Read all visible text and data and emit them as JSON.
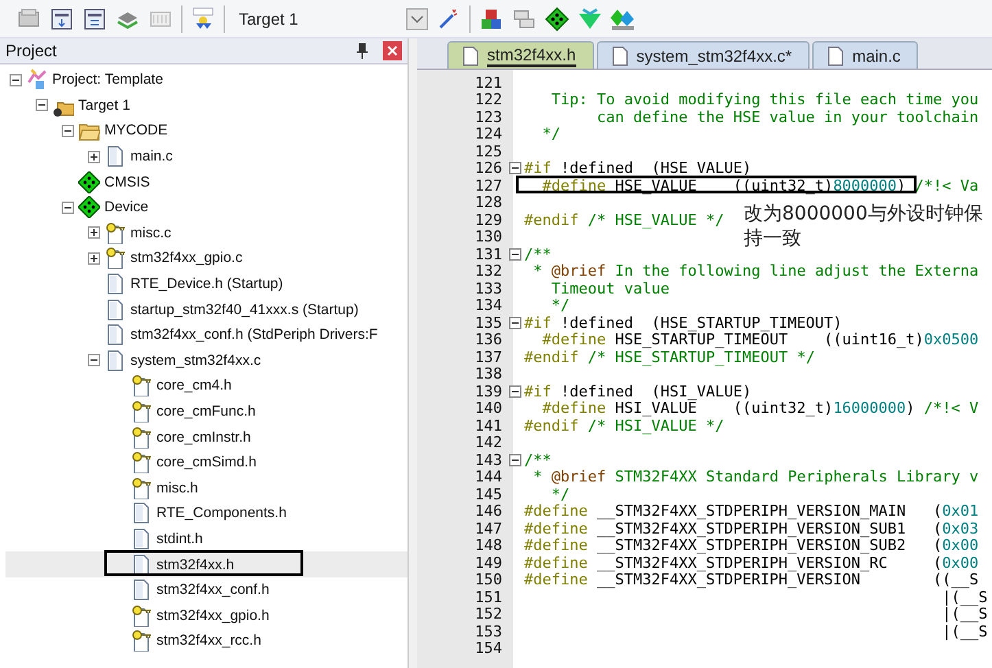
{
  "toolbar": {
    "target": "Target 1"
  },
  "project_panel": {
    "title": "Project",
    "tree": [
      {
        "label": "Project: Template",
        "kind": "project",
        "expanded": true,
        "children": [
          {
            "label": "Target 1",
            "kind": "target",
            "expanded": true,
            "children": [
              {
                "label": "MYCODE",
                "kind": "folder",
                "expanded": true,
                "children": [
                  {
                    "label": "main.c",
                    "kind": "file",
                    "expanded": false,
                    "selected": false,
                    "marked": false
                  }
                ]
              },
              {
                "label": "CMSIS",
                "kind": "component"
              },
              {
                "label": "Device",
                "kind": "component",
                "expanded": true,
                "children": [
                  {
                    "label": "misc.c",
                    "kind": "file-key",
                    "expanded": false,
                    "selected": false,
                    "marked": false
                  },
                  {
                    "label": "stm32f4xx_gpio.c",
                    "kind": "file-key",
                    "expanded": false,
                    "selected": false,
                    "marked": false
                  },
                  {
                    "label": "RTE_Device.h (Startup)",
                    "kind": "file",
                    "selected": false,
                    "marked": false
                  },
                  {
                    "label": "startup_stm32f40_41xxx.s (Startup)",
                    "kind": "file",
                    "selected": false,
                    "marked": false
                  },
                  {
                    "label": "stm32f4xx_conf.h (StdPeriph Drivers:F",
                    "kind": "file",
                    "selected": false,
                    "marked": false
                  },
                  {
                    "label": "system_stm32f4xx.c",
                    "kind": "file",
                    "expanded": true,
                    "selected": false,
                    "marked": false,
                    "children": [
                      {
                        "label": "core_cm4.h",
                        "kind": "file-key",
                        "selected": false,
                        "marked": false
                      },
                      {
                        "label": "core_cmFunc.h",
                        "kind": "file-key",
                        "selected": false,
                        "marked": false
                      },
                      {
                        "label": "core_cmInstr.h",
                        "kind": "file-key",
                        "selected": false,
                        "marked": false
                      },
                      {
                        "label": "core_cmSimd.h",
                        "kind": "file-key",
                        "selected": false,
                        "marked": false
                      },
                      {
                        "label": "misc.h",
                        "kind": "file-key",
                        "selected": false,
                        "marked": false
                      },
                      {
                        "label": "RTE_Components.h",
                        "kind": "file",
                        "selected": false,
                        "marked": false
                      },
                      {
                        "label": "stdint.h",
                        "kind": "file",
                        "selected": false,
                        "marked": false
                      },
                      {
                        "label": "stm32f4xx.h",
                        "kind": "file",
                        "selected": true,
                        "marked": true
                      },
                      {
                        "label": "stm32f4xx_conf.h",
                        "kind": "file",
                        "selected": false,
                        "marked": false
                      },
                      {
                        "label": "stm32f4xx_gpio.h",
                        "kind": "file-key",
                        "selected": false,
                        "marked": false
                      },
                      {
                        "label": "stm32f4xx_rcc.h",
                        "kind": "file-key",
                        "selected": false,
                        "marked": false
                      }
                    ]
                  }
                ]
              }
            ]
          }
        ]
      }
    ]
  },
  "tabs": [
    {
      "label": "stm32f4xx.h",
      "selected": true
    },
    {
      "label": "system_stm32f4xx.c*",
      "selected": false
    },
    {
      "label": "main.c",
      "selected": false
    }
  ],
  "editor": {
    "annotation": "改为8000000与外设时钟保持一致",
    "lines": [
      {
        "number": "121"
      },
      {
        "number": "122",
        "tokens": [
          {
            "kind": "cmt",
            "t": "   Tip: To avoid modifying this file each time you"
          }
        ]
      },
      {
        "number": "123",
        "tokens": [
          {
            "kind": "cmt",
            "t": "        can define the HSE value in your toolchain"
          }
        ]
      },
      {
        "number": "124",
        "tokens": [
          {
            "kind": "cmt",
            "t": "  */"
          }
        ]
      },
      {
        "number": "125"
      },
      {
        "number": "126",
        "fold": true,
        "tokens": [
          {
            "kind": "pp",
            "t": "#if"
          },
          {
            "kind": "plain",
            "t": " !defined  (HSE_VALUE)"
          }
        ]
      },
      {
        "number": "127",
        "marked": true,
        "tokens": [
          {
            "kind": "pp",
            "t": "  #define"
          },
          {
            "kind": "plain",
            "t": " HSE_VALUE    ((uint32_t)"
          },
          {
            "kind": "num",
            "t": "8000000"
          },
          {
            "kind": "plain",
            "t": ") "
          },
          {
            "kind": "cmt",
            "t": "/*!< Va"
          }
        ]
      },
      {
        "number": "128"
      },
      {
        "number": "129",
        "tokens": [
          {
            "kind": "pp",
            "t": "#endif"
          },
          {
            "kind": "cmt",
            "t": " /* HSE_VALUE */"
          }
        ]
      },
      {
        "number": "130"
      },
      {
        "number": "131",
        "fold": true,
        "tokens": [
          {
            "kind": "cmt",
            "t": "/**"
          }
        ]
      },
      {
        "number": "132",
        "tokens": [
          {
            "kind": "cmt",
            "t": " * "
          },
          {
            "kind": "doc",
            "t": "@brief"
          },
          {
            "kind": "cmt",
            "t": " In the following line adjust the Externa"
          }
        ]
      },
      {
        "number": "133",
        "tokens": [
          {
            "kind": "cmt",
            "t": "   Timeout value"
          }
        ]
      },
      {
        "number": "134",
        "tokens": [
          {
            "kind": "cmt",
            "t": "   */"
          }
        ]
      },
      {
        "number": "135",
        "fold": true,
        "tokens": [
          {
            "kind": "pp",
            "t": "#if"
          },
          {
            "kind": "plain",
            "t": " !defined  (HSE_STARTUP_TIMEOUT)"
          }
        ]
      },
      {
        "number": "136",
        "tokens": [
          {
            "kind": "pp",
            "t": "  #define"
          },
          {
            "kind": "plain",
            "t": " HSE_STARTUP_TIMEOUT    ((uint16_t)"
          },
          {
            "kind": "num",
            "t": "0x0500"
          }
        ]
      },
      {
        "number": "137",
        "tokens": [
          {
            "kind": "pp",
            "t": "#endif"
          },
          {
            "kind": "cmt",
            "t": " /* HSE_STARTUP_TIMEOUT */"
          }
        ]
      },
      {
        "number": "138"
      },
      {
        "number": "139",
        "fold": true,
        "tokens": [
          {
            "kind": "pp",
            "t": "#if"
          },
          {
            "kind": "plain",
            "t": " !defined  (HSI_VALUE)"
          }
        ]
      },
      {
        "number": "140",
        "tokens": [
          {
            "kind": "pp",
            "t": "  #define"
          },
          {
            "kind": "plain",
            "t": " HSI_VALUE    ((uint32_t)"
          },
          {
            "kind": "num",
            "t": "16000000"
          },
          {
            "kind": "plain",
            "t": ") "
          },
          {
            "kind": "cmt",
            "t": "/*!< V"
          }
        ]
      },
      {
        "number": "141",
        "tokens": [
          {
            "kind": "pp",
            "t": "#endif"
          },
          {
            "kind": "cmt",
            "t": " /* HSI_VALUE */"
          }
        ]
      },
      {
        "number": "142"
      },
      {
        "number": "143",
        "fold": true,
        "tokens": [
          {
            "kind": "cmt",
            "t": "/**"
          }
        ]
      },
      {
        "number": "144",
        "tokens": [
          {
            "kind": "cmt",
            "t": " * "
          },
          {
            "kind": "doc",
            "t": "@brief"
          },
          {
            "kind": "cmt",
            "t": " STM32F4XX Standard Peripherals Library v"
          }
        ]
      },
      {
        "number": "145",
        "tokens": [
          {
            "kind": "cmt",
            "t": "   */"
          }
        ]
      },
      {
        "number": "146",
        "tokens": [
          {
            "kind": "pp",
            "t": "#define"
          },
          {
            "kind": "plain",
            "t": " __STM32F4XX_STDPERIPH_VERSION_MAIN   ("
          },
          {
            "kind": "num",
            "t": "0x01"
          }
        ]
      },
      {
        "number": "147",
        "tokens": [
          {
            "kind": "pp",
            "t": "#define"
          },
          {
            "kind": "plain",
            "t": " __STM32F4XX_STDPERIPH_VERSION_SUB1   ("
          },
          {
            "kind": "num",
            "t": "0x03"
          }
        ]
      },
      {
        "number": "148",
        "tokens": [
          {
            "kind": "pp",
            "t": "#define"
          },
          {
            "kind": "plain",
            "t": " __STM32F4XX_STDPERIPH_VERSION_SUB2   ("
          },
          {
            "kind": "num",
            "t": "0x00"
          }
        ]
      },
      {
        "number": "149",
        "tokens": [
          {
            "kind": "pp",
            "t": "#define"
          },
          {
            "kind": "plain",
            "t": " __STM32F4XX_STDPERIPH_VERSION_RC     ("
          },
          {
            "kind": "num",
            "t": "0x00"
          }
        ]
      },
      {
        "number": "150",
        "tokens": [
          {
            "kind": "pp",
            "t": "#define"
          },
          {
            "kind": "plain",
            "t": " __STM32F4XX_STDPERIPH_VERSION        ((__S"
          }
        ]
      },
      {
        "number": "151",
        "tokens": [
          {
            "kind": "plain",
            "t": "                                              |(__S"
          }
        ]
      },
      {
        "number": "152",
        "tokens": [
          {
            "kind": "plain",
            "t": "                                              |(__S"
          }
        ]
      },
      {
        "number": "153",
        "tokens": [
          {
            "kind": "plain",
            "t": "                                              |(__S"
          }
        ]
      },
      {
        "number": "154"
      }
    ]
  }
}
